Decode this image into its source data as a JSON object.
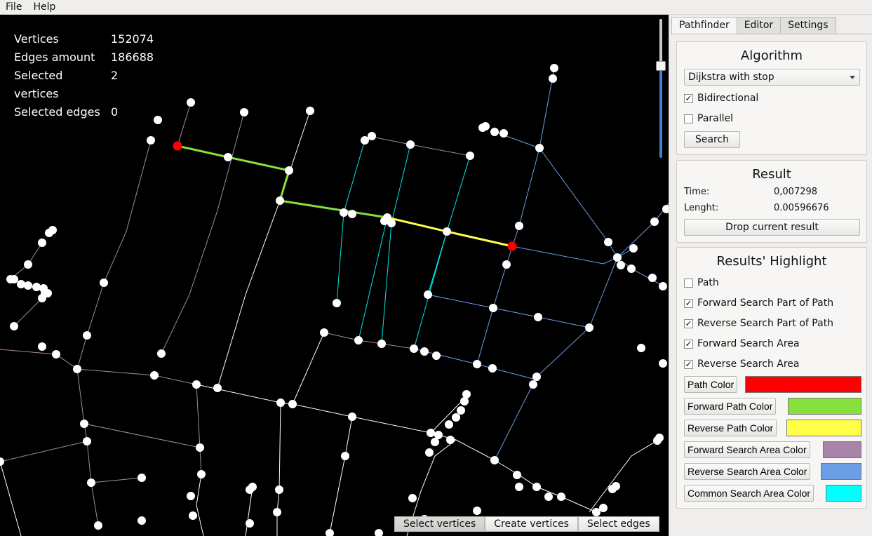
{
  "menu": {
    "file": "File",
    "help": "Help"
  },
  "stats": {
    "vertices_label": "Vertices",
    "vertices_value": "152074",
    "edges_label": "Edges amount",
    "edges_value": "186688",
    "sel_vertices_label": "Selected vertices",
    "sel_vertices_value": "2",
    "sel_edges_label": "Selected edges",
    "sel_edges_value": "0"
  },
  "mode_buttons": {
    "select_vertices": "Select vertices",
    "create_vertices": "Create vertices",
    "select_edges": "Select edges"
  },
  "tabs": {
    "pathfinder": "Pathfinder",
    "editor": "Editor",
    "settings": "Settings"
  },
  "algorithm": {
    "title": "Algorithm",
    "selected": "Dijkstra with stop",
    "bidirectional_label": "Bidirectional",
    "bidirectional_checked": true,
    "parallel_label": "Parallel",
    "parallel_checked": false,
    "search_label": "Search"
  },
  "result": {
    "title": "Result",
    "time_label": "Time:",
    "time_value": "0,007298",
    "length_label": "Lenght:",
    "length_value": "0.00596676",
    "drop_label": "Drop current result"
  },
  "highlight": {
    "title": "Results' Highlight",
    "options": [
      {
        "label": "Path",
        "checked": false
      },
      {
        "label": "Forward Search Part of Path",
        "checked": true
      },
      {
        "label": "Reverse Search Part of Path",
        "checked": true
      },
      {
        "label": "Forward Search Area",
        "checked": true
      },
      {
        "label": "Reverse Search Area",
        "checked": true
      }
    ],
    "colors": [
      {
        "label": "Path Color",
        "color": "#ff0000"
      },
      {
        "label": "Forward Path Color",
        "color": "#88e03c"
      },
      {
        "label": "Reverse Path Color",
        "color": "#ffff48"
      },
      {
        "label": "Forward Search Area Color",
        "color": "#a884a8"
      },
      {
        "label": "Reverse Search Area Color",
        "color": "#6c9ee6"
      },
      {
        "label": "Common Search Area Color",
        "color": "#00ffff"
      }
    ]
  },
  "accent_colors": {
    "slider": "#3b84d2",
    "canvas_bg": "#000000",
    "edge_default": "#ffffff"
  }
}
